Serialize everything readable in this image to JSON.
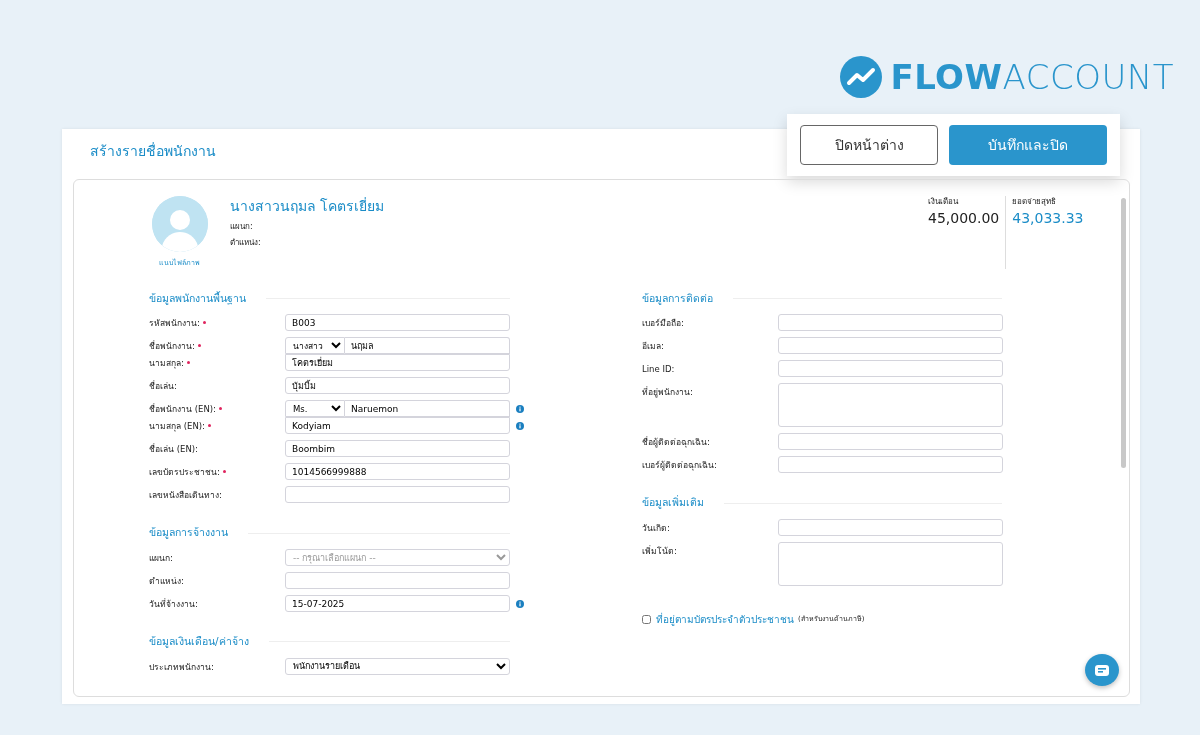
{
  "brand": {
    "name_bold": "FLOW",
    "name_light": "ACCOUNT"
  },
  "page_title": "สร้างรายชื่อพนักงาน",
  "buttons": [
    {
      "label": "ปิดหน้าต่าง",
      "kind": "outline"
    },
    {
      "label": "บันทึกและปิด",
      "kind": "primary"
    }
  ],
  "profile": {
    "name": "นางสาวนฤมล โคตรเยี่ยม",
    "department_label": "แผนก:",
    "position_label": "ตำแหน่ง:",
    "upload_label": "แนบไฟล์ภาพ"
  },
  "totals": [
    {
      "label": "เงินเดือน",
      "value": "45,000.00",
      "kind": "plain"
    },
    {
      "label": "ยอดจ่ายสุทธิ",
      "value": "43,033.33",
      "kind": "accent"
    }
  ],
  "left_sections": [
    {
      "title": "ข้อมูลพนักงานพื้นฐาน",
      "fields": [
        {
          "label": "รหัสพนักงาน:",
          "kind": "text",
          "value": "B003",
          "required": true,
          "info": false,
          "joined": false
        },
        {
          "label": "ชื่อพนักงาน:",
          "kind": "prefixed",
          "prefix": "นางสาว",
          "value": "นฤมล",
          "required": true,
          "info": false,
          "joined": false
        },
        {
          "label": "นามสกุล:",
          "kind": "text",
          "value": "โคตรเยี่ยม",
          "required": true,
          "info": false,
          "joined": true
        },
        {
          "label": "ชื่อเล่น:",
          "kind": "text",
          "value": "บุ้มบิ้ม",
          "required": false,
          "info": false,
          "joined": false
        },
        {
          "label": "ชื่อพนักงาน (EN):",
          "kind": "prefixed",
          "prefix": "Ms.",
          "value": "Naruemon",
          "required": true,
          "info": true,
          "joined": false
        },
        {
          "label": "นามสกุล (EN):",
          "kind": "text",
          "value": "Kodyiam",
          "required": true,
          "info": true,
          "joined": true
        },
        {
          "label": "ชื่อเล่น (EN):",
          "kind": "text",
          "value": "Boombim",
          "required": false,
          "info": false,
          "joined": false
        },
        {
          "label": "เลขบัตรประชาชน:",
          "kind": "text",
          "value": "1014566999888",
          "required": true,
          "info": false,
          "joined": false
        },
        {
          "label": "เลขหนังสือเดินทาง:",
          "kind": "text",
          "required": false,
          "info": false,
          "joined": false
        }
      ]
    },
    {
      "title": "ข้อมูลการจ้างงาน",
      "fields": [
        {
          "label": "แผนก:",
          "kind": "select",
          "placeholder": "-- กรุณาเลือกแผนก --",
          "required": false,
          "info": false,
          "joined": false
        },
        {
          "label": "ตำแหน่ง:",
          "kind": "text",
          "required": false,
          "info": false,
          "joined": false
        },
        {
          "label": "วันที่จ้างงาน:",
          "kind": "text",
          "value": "15-07-2025",
          "required": false,
          "info": true,
          "joined": false
        }
      ]
    },
    {
      "title": "ข้อมูลเงินเดือน/ค่าจ้าง",
      "fields": [
        {
          "label": "ประเภทพนักงาน:",
          "kind": "select",
          "value": "พนักงานรายเดือน",
          "required": false,
          "info": false,
          "joined": false
        }
      ]
    }
  ],
  "right_sections": [
    {
      "title": "ข้อมูลการติดต่อ",
      "fields": [
        {
          "label": "เบอร์มือถือ:",
          "kind": "text"
        },
        {
          "label": "อีเมล:",
          "kind": "text"
        },
        {
          "label": "Line ID:",
          "kind": "text"
        },
        {
          "label": "ที่อยู่พนักงาน:",
          "kind": "textarea"
        },
        {
          "label": "ชื่อผู้ติดต่อฉุกเฉิน:",
          "kind": "text"
        },
        {
          "label": "เบอร์ผู้ติดต่อฉุกเฉิน:",
          "kind": "text"
        }
      ]
    },
    {
      "title": "ข้อมูลเพิ่มเติม",
      "fields": [
        {
          "label": "วันเกิด:",
          "kind": "text"
        },
        {
          "label": "เพิ่มโน้ต:",
          "kind": "textarea"
        }
      ]
    }
  ],
  "id_address": {
    "label": "ที่อยู่ตามบัตรประจำตัวประชาชน",
    "note": "(สำหรับงานด้านภาษี)",
    "checked": false
  }
}
